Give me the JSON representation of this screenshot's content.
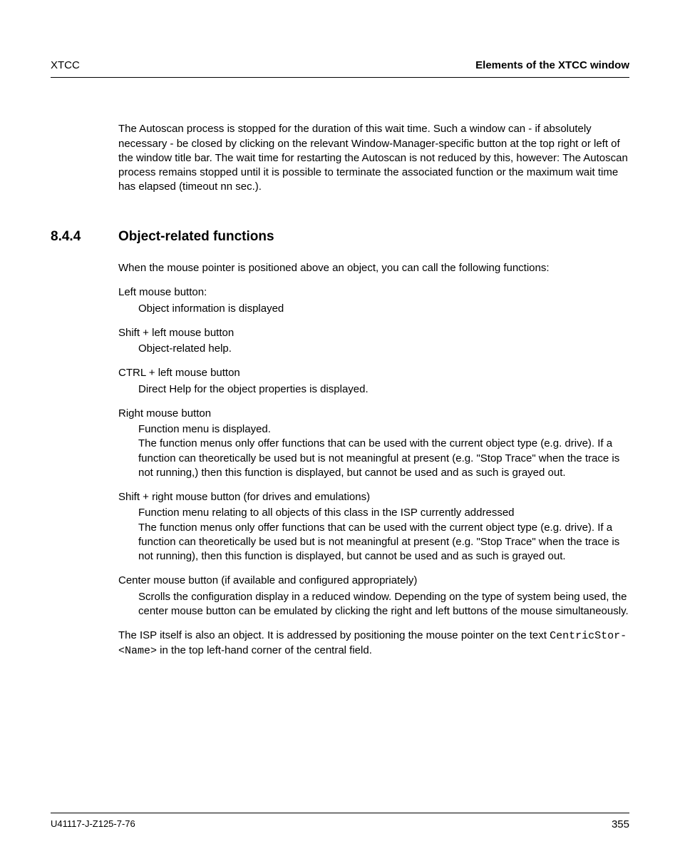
{
  "header": {
    "left": "XTCC",
    "right": "Elements of the XTCC window"
  },
  "intro": "The Autoscan process is stopped for the duration of this wait time. Such a window can - if absolutely necessary - be closed by clicking on the relevant Window-Manager-specific button at the top right or left of the window title bar. The wait time for restarting the Autoscan is not reduced by this, however: The Autoscan process remains stopped until it is possible to terminate the associated function or the maximum wait time has elapsed (timeout nn sec.).",
  "section": {
    "number": "8.4.4",
    "title": "Object-related functions"
  },
  "lead": "When the mouse pointer is positioned above an object, you can call the following functions:",
  "defs": [
    {
      "term": "Left mouse button:",
      "desc": "Object information is displayed"
    },
    {
      "term": "Shift + left mouse button",
      "desc": "Object-related help."
    },
    {
      "term": "CTRL + left mouse button",
      "desc": "Direct Help for the object properties is displayed."
    },
    {
      "term": "Right mouse button",
      "desc": "Function menu is displayed.\nThe function menus only offer functions that can be used with the current object type (e.g. drive). If a function can theoretically be used but is not meaningful at present (e.g. \"Stop Trace\" when the trace is not running,) then this function is displayed, but cannot be used and as such is grayed out."
    },
    {
      "term": "Shift + right mouse button (for drives and emulations)",
      "desc": "Function menu relating to all objects of this class in the ISP currently addressed\nThe function menus only offer functions that can be used with the current object type (e.g. drive). If a function can theoretically be used but is not meaningful at present (e.g. \"Stop Trace\" when the trace is not running), then this function is displayed, but cannot be used and as such is grayed out."
    },
    {
      "term": "Center mouse button (if available and configured appropriately)",
      "desc": "Scrolls the configuration display in a reduced window. Depending on the type of system being used, the center mouse button can be emulated by clicking the right and left buttons of the mouse simultaneously."
    }
  ],
  "closing": {
    "part1": "The ISP itself is also an object. It is addressed by positioning the mouse pointer on the text ",
    "mono": "CentricStor-<Name>",
    "part2": " in the top left-hand corner of the central field."
  },
  "footer": {
    "left": "U41117-J-Z125-7-76",
    "page": "355"
  }
}
